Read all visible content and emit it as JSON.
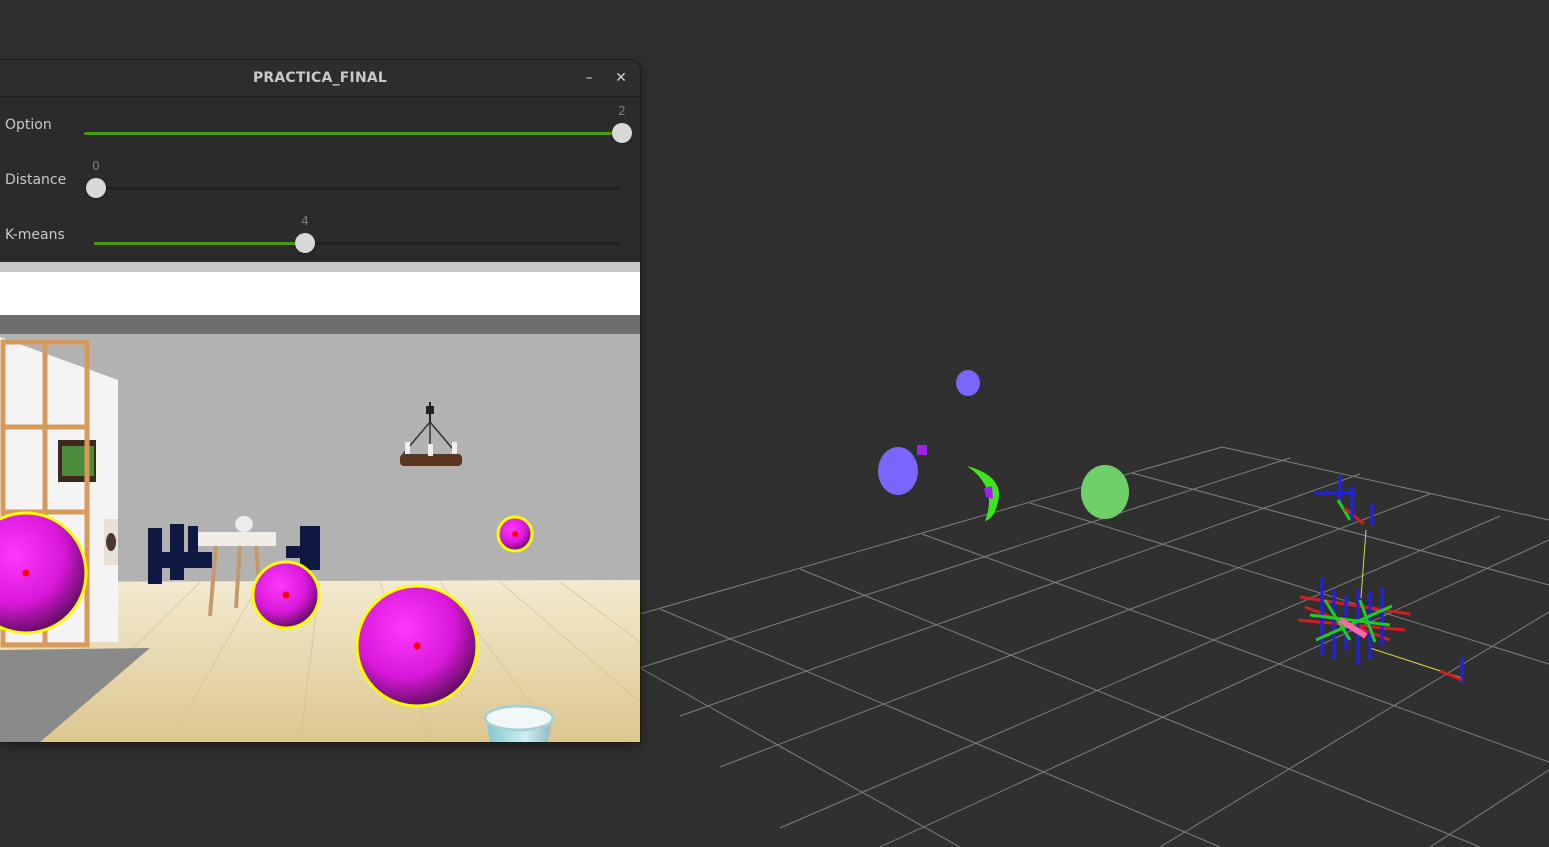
{
  "window": {
    "title": "PRACTICA_FINAL",
    "minimize_glyph": "–",
    "close_glyph": "✕"
  },
  "trackbars": [
    {
      "label": "Option",
      "value": "2",
      "fraction": 1.0
    },
    {
      "label": "Distance",
      "value": "0",
      "fraction": 0.0
    },
    {
      "label": "K-means",
      "value": "4",
      "fraction": 0.4
    }
  ],
  "camera": {
    "detected_ball_count": 4,
    "ball_color": "#e21ae2",
    "outline_color": "#ffff00",
    "center_color": "#ff0000"
  },
  "viewer": {
    "background": "#303030",
    "grid_color": "#a0a0a0",
    "cluster_colors": [
      "#7a66ff",
      "#3fe31f",
      "#6fd06a",
      "#a020f0"
    ],
    "axis_colors": {
      "x": "#cc2020",
      "y": "#20cc20",
      "z": "#2020ee"
    }
  }
}
